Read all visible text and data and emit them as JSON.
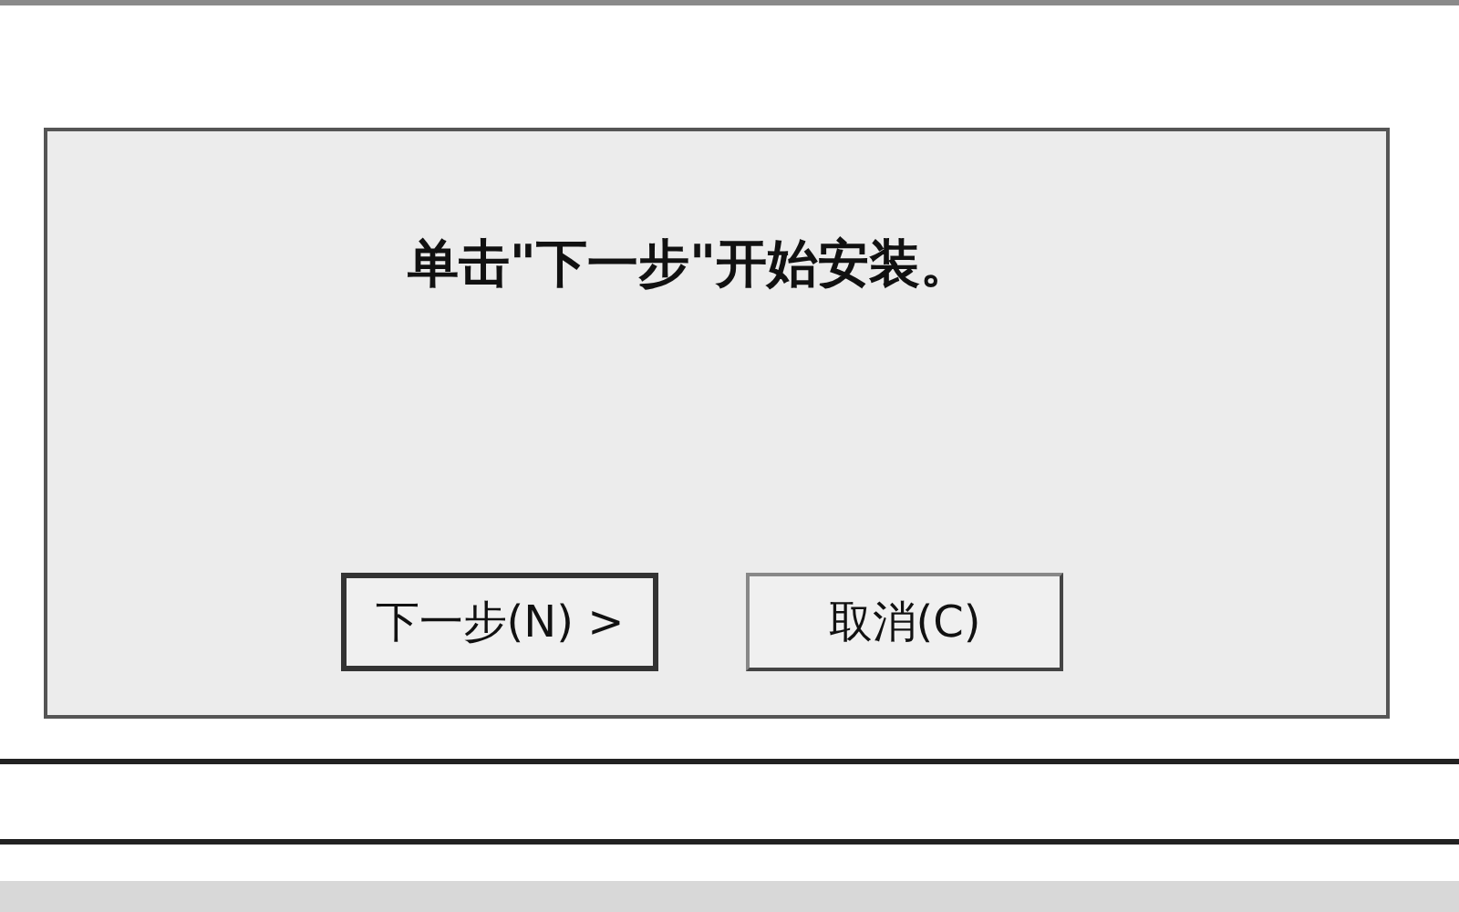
{
  "dialog": {
    "message": "单击\"下一步\"开始安装。",
    "buttons": [
      {
        "label": "下一步(N) >",
        "default": true
      },
      {
        "label": "取消(C)",
        "default": false
      }
    ]
  }
}
